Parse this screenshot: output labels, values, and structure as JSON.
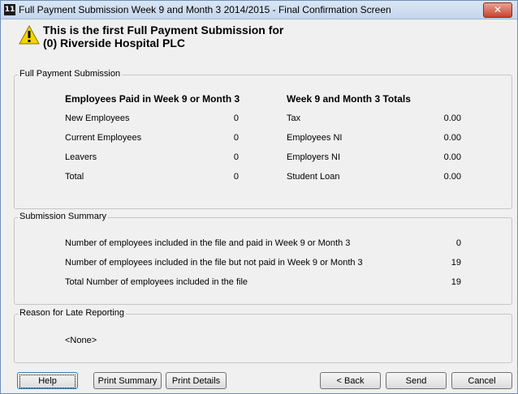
{
  "window": {
    "title": "Full Payment Submission Week 9 and Month 3 2014/2015 - Final Confirmation Screen",
    "app_icon_text": "11",
    "close_glyph": "✕"
  },
  "header": {
    "line1": "This is the first Full Payment Submission for",
    "line2": "(0) Riverside Hospital PLC"
  },
  "fps": {
    "legend": "Full Payment Submission",
    "employees_heading": "Employees Paid in Week 9 or Month 3",
    "totals_heading": "Week 9 and Month 3 Totals",
    "employees": [
      {
        "label": "New Employees",
        "value": "0"
      },
      {
        "label": "Current Employees",
        "value": "0"
      },
      {
        "label": "Leavers",
        "value": "0"
      },
      {
        "label": "Total",
        "value": "0"
      }
    ],
    "totals": [
      {
        "label": "Tax",
        "value": "0.00"
      },
      {
        "label": "Employees NI",
        "value": "0.00"
      },
      {
        "label": "Employers NI",
        "value": "0.00"
      },
      {
        "label": "Student Loan",
        "value": "0.00"
      }
    ]
  },
  "summary": {
    "legend": "Submission Summary",
    "rows": [
      {
        "label": "Number of employees included in the file and paid in Week 9 or Month 3",
        "value": "0"
      },
      {
        "label": "Number of employees included in the file but not paid in Week 9 or Month 3",
        "value": "19"
      },
      {
        "label": "Total Number of employees included in the file",
        "value": "19"
      }
    ]
  },
  "late": {
    "legend": "Reason for Late Reporting",
    "value": "<None>"
  },
  "buttons": {
    "help": "Help",
    "print_summary": "Print Summary",
    "print_details": "Print Details",
    "back": "< Back",
    "send": "Send",
    "cancel": "Cancel"
  },
  "colors": {
    "title_bar": "#c4d6ec",
    "close_button": "#c7442f",
    "warning": "#f5d400"
  },
  "icons": {
    "app": "application-icon",
    "warning": "warning-icon",
    "close": "close-icon"
  }
}
